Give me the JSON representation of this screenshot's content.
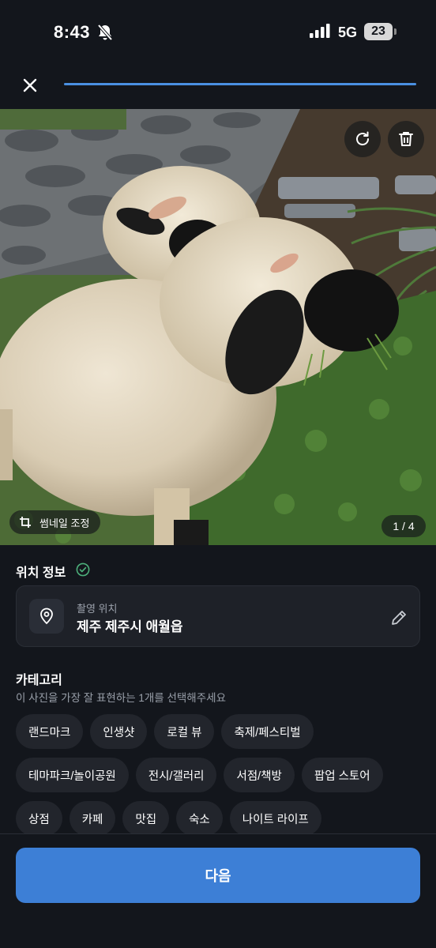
{
  "status": {
    "time": "8:43",
    "network": "5G",
    "battery": "23"
  },
  "progress": 1.0,
  "photo": {
    "thumbnail_label": "썸네일 조정",
    "counter": "1 / 4"
  },
  "location": {
    "title": "위치 정보",
    "label": "촬영 위치",
    "value": "제주 제주시 애월읍"
  },
  "category": {
    "title": "카테고리",
    "subtitle": "이 사진을 가장 잘 표현하는 1개를 선택해주세요",
    "chips": [
      "랜드마크",
      "인생샷",
      "로컬 뷰",
      "축제/페스티벌",
      "테마파크/놀이공원",
      "전시/갤러리",
      "서점/책방",
      "팝업 스토어",
      "상점",
      "카페",
      "맛집",
      "숙소",
      "나이트 라이프"
    ]
  },
  "next_label": "다음"
}
